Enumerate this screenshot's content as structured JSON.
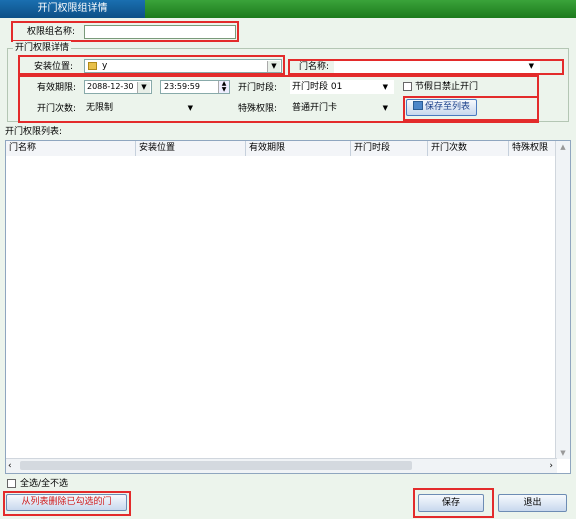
{
  "window": {
    "title": "开门权限组详情"
  },
  "group_name": {
    "label": "权限组名称:",
    "value": ""
  },
  "details_group": {
    "legend": "开门权限详情"
  },
  "install_location": {
    "label": "安装位置:",
    "value": "y"
  },
  "door_name": {
    "label": "门名称:",
    "value": ""
  },
  "validity": {
    "label": "有效期限:",
    "date": "2088-12-30",
    "time": "23:59:59"
  },
  "open_period": {
    "label": "开门时段:",
    "value": "开门时段 01"
  },
  "holiday_disable": {
    "label": "节假日禁止开门",
    "checked": false
  },
  "open_count": {
    "label": "开门次数:",
    "value": "无限制"
  },
  "special_permission": {
    "label": "特殊权限:",
    "value": "普通开门卡"
  },
  "save_to_list": {
    "label": "保存至列表"
  },
  "permission_list": {
    "label": "开门权限列表:",
    "columns": [
      "门名称",
      "安装位置",
      "有效期限",
      "开门时段",
      "开门次数",
      "特殊权限"
    ],
    "rows": []
  },
  "select_all": {
    "label": "全选/全不选",
    "checked": false
  },
  "delete_selected": {
    "label": "从列表删除已勾选的门"
  },
  "save_button": {
    "label": "保存"
  },
  "exit_button": {
    "label": "退出"
  },
  "colors": {
    "accent_red": "#e32b2b",
    "title_green": "#1c7a1c",
    "title_tab_blue": "#0d4f86"
  }
}
